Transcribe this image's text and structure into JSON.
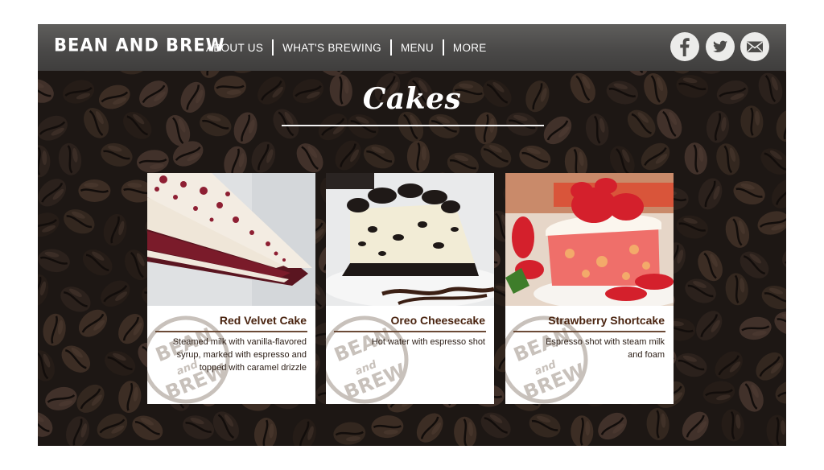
{
  "brand": "BEAN AND BREW",
  "nav": {
    "items": [
      "ABOUT US",
      "WHAT'S BREWING",
      "MENU",
      "MORE"
    ]
  },
  "social": {
    "icons": [
      "facebook-icon",
      "twitter-icon",
      "email-icon"
    ]
  },
  "page": {
    "heading": "Cakes"
  },
  "cards": [
    {
      "title": "Red Velvet Cake",
      "description": "Steamed milk with vanilla-flavored syrup, marked with espresso and topped with caramel drizzle",
      "watermark": "BEAN and BREW"
    },
    {
      "title": "Oreo Cheesecake",
      "description": "Hot water with espresso shot",
      "watermark": "BEAN and BREW"
    },
    {
      "title": "Strawberry Shortcake",
      "description": "Espresso shot with steam milk and foam",
      "watermark": "BEAN and BREW"
    }
  ],
  "colors": {
    "navbar": "#4a4948",
    "background": "#1c1714",
    "card_title": "#4a2410",
    "stamp": "#c8c1bb"
  }
}
